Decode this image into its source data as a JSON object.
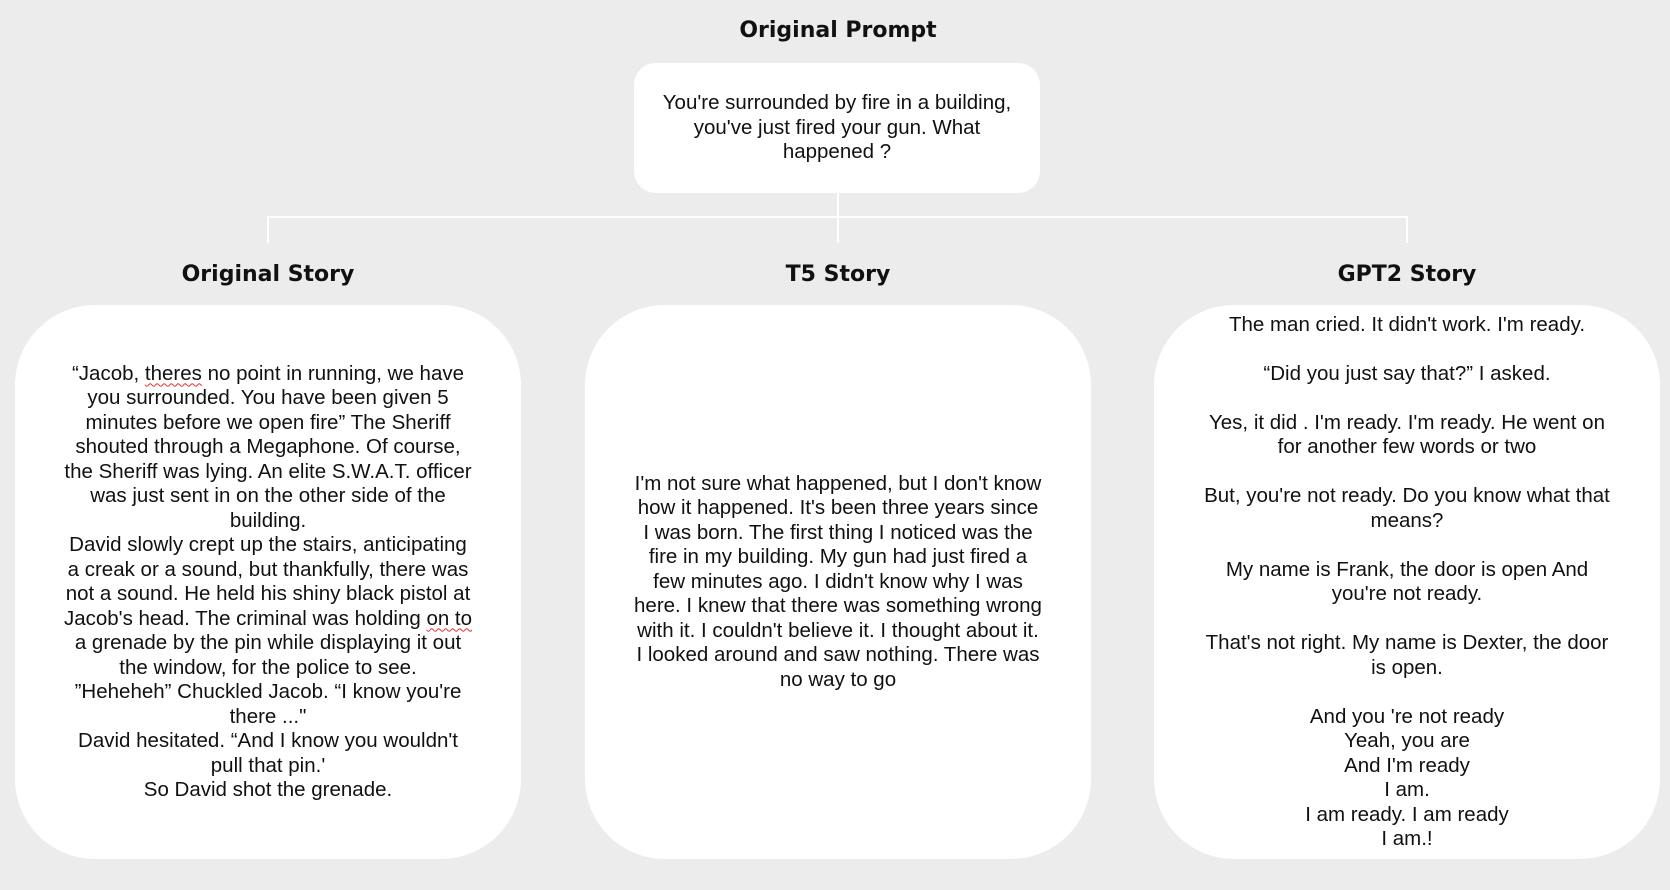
{
  "prompt": {
    "heading": "Original Prompt",
    "text": "You're surrounded by fire in a building,\nyou've just fired your gun. What\nhappened ?"
  },
  "stories": [
    {
      "heading": "Original Story",
      "parts": [
        "“Jacob, ",
        "theres",
        " no point in running, we have\nyou surrounded. You have been given 5\nminutes before we open fire” The Sheriff\nshouted through a Megaphone. Of course,\nthe Sheriff was lying. An elite S.W.A.T. officer\nwas just sent in on the other side of the\nbuilding.\nDavid slowly crept up the stairs, anticipating\na creak or a sound, but thankfully, there was\nnot a sound. He held his shiny black pistol at\nJacob's head. The criminal was holding ",
        "on to",
        "\na grenade by the pin while displaying it out\nthe window, for the police to see.\n”Heheheh” Chuckled Jacob. “I know you're\nthere ...\"\nDavid hesitated. “And I know you wouldn't\npull that pin.'\nSo David shot the grenade."
      ]
    },
    {
      "heading": "T5 Story",
      "text": "I'm not sure what happened, but I don't know\nhow it happened. It's been three years since\nI was born. The first thing I noticed was the\nfire in my building. My gun had just fired a\nfew minutes ago. I didn't know why I was\nhere. I knew that there was something wrong\nwith it. I couldn't believe it. I thought about it.\nI looked around and saw nothing. There was\nno way to go"
    },
    {
      "heading": "GPT2 Story",
      "text": "The man cried. It didn't work. I'm ready.\n\n“Did you just say that?” I asked.\n\nYes, it did . I'm ready. I'm ready. He went on\nfor another few words or two\n\nBut, you're not ready. Do you know what that\nmeans?\n\nMy name is Frank, the door is open And\nyou're not ready.\n\nThat's not right. My name is Dexter, the door\nis open.\n\nAnd you 're not ready\nYeah, you are\nAnd I'm ready\nI am.\nI am ready. I am ready\nI am.!"
    }
  ],
  "colors": {
    "background": "#ececec",
    "box": "#ffffff",
    "connector": "#ffffff",
    "spellcheck_underline": "#d33"
  }
}
